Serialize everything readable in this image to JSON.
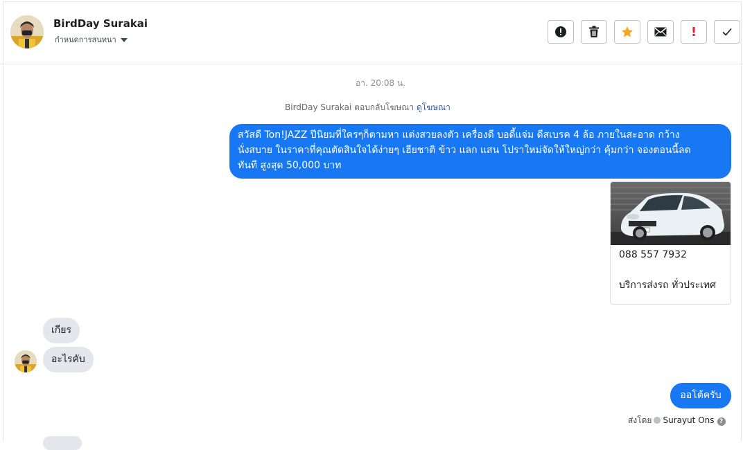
{
  "header": {
    "name": "BirdDay Surakai",
    "subtitle": "กำหนดการสนทนา",
    "tools": [
      {
        "icon": "alert-circle-icon",
        "label": "!"
      },
      {
        "icon": "trash-icon",
        "label": ""
      },
      {
        "icon": "star-icon",
        "label": ""
      },
      {
        "icon": "envelope-icon",
        "label": ""
      },
      {
        "icon": "exclamation-icon",
        "label": "!"
      },
      {
        "icon": "check-icon",
        "label": "✓"
      }
    ]
  },
  "conversation": {
    "timestamp": "อา. 20:08 น.",
    "reply_note": "BirdDay Surakai ตอบกลับโฆษณา",
    "reply_link": "ดูโฆษณา",
    "outgoing_lines": [
      "สวัสดี Ton!JAZZ ปีนิยมที่ใครๆก็ตามหา แต่งสวยลงตัว เครื่องดี บอดี้แจ่ม ดีสเบรค 4 ล้อ ภายในสะอาด กว้าง",
      "นั่งสบาย ในราคาที่คุณตัดสินใจได้ง่ายๆ เฮียชาติ ข้าว แลก แสน โปราใหม่จัดให้ใหญ่กว่า คุ้มกว่า จองตอนนี้ลด",
      "ทันที สูงสุด 50,000 บาท"
    ],
    "ad_card": {
      "phone": "088 557 7932",
      "description": "บริการส่งรถ ทั่วประเทศ"
    },
    "incoming": [
      {
        "text": "เกียร"
      },
      {
        "text": "อะไรคับ"
      }
    ],
    "reply": "ออโต้ครับ",
    "sent_by_label": "ส่งโดย",
    "sent_by_name": "Surayut Ons"
  },
  "colors": {
    "accent": "#1877f2",
    "incoming_bubble": "#e4e6eb",
    "star": "#f5a524",
    "alert_red": "#e41e3f"
  }
}
